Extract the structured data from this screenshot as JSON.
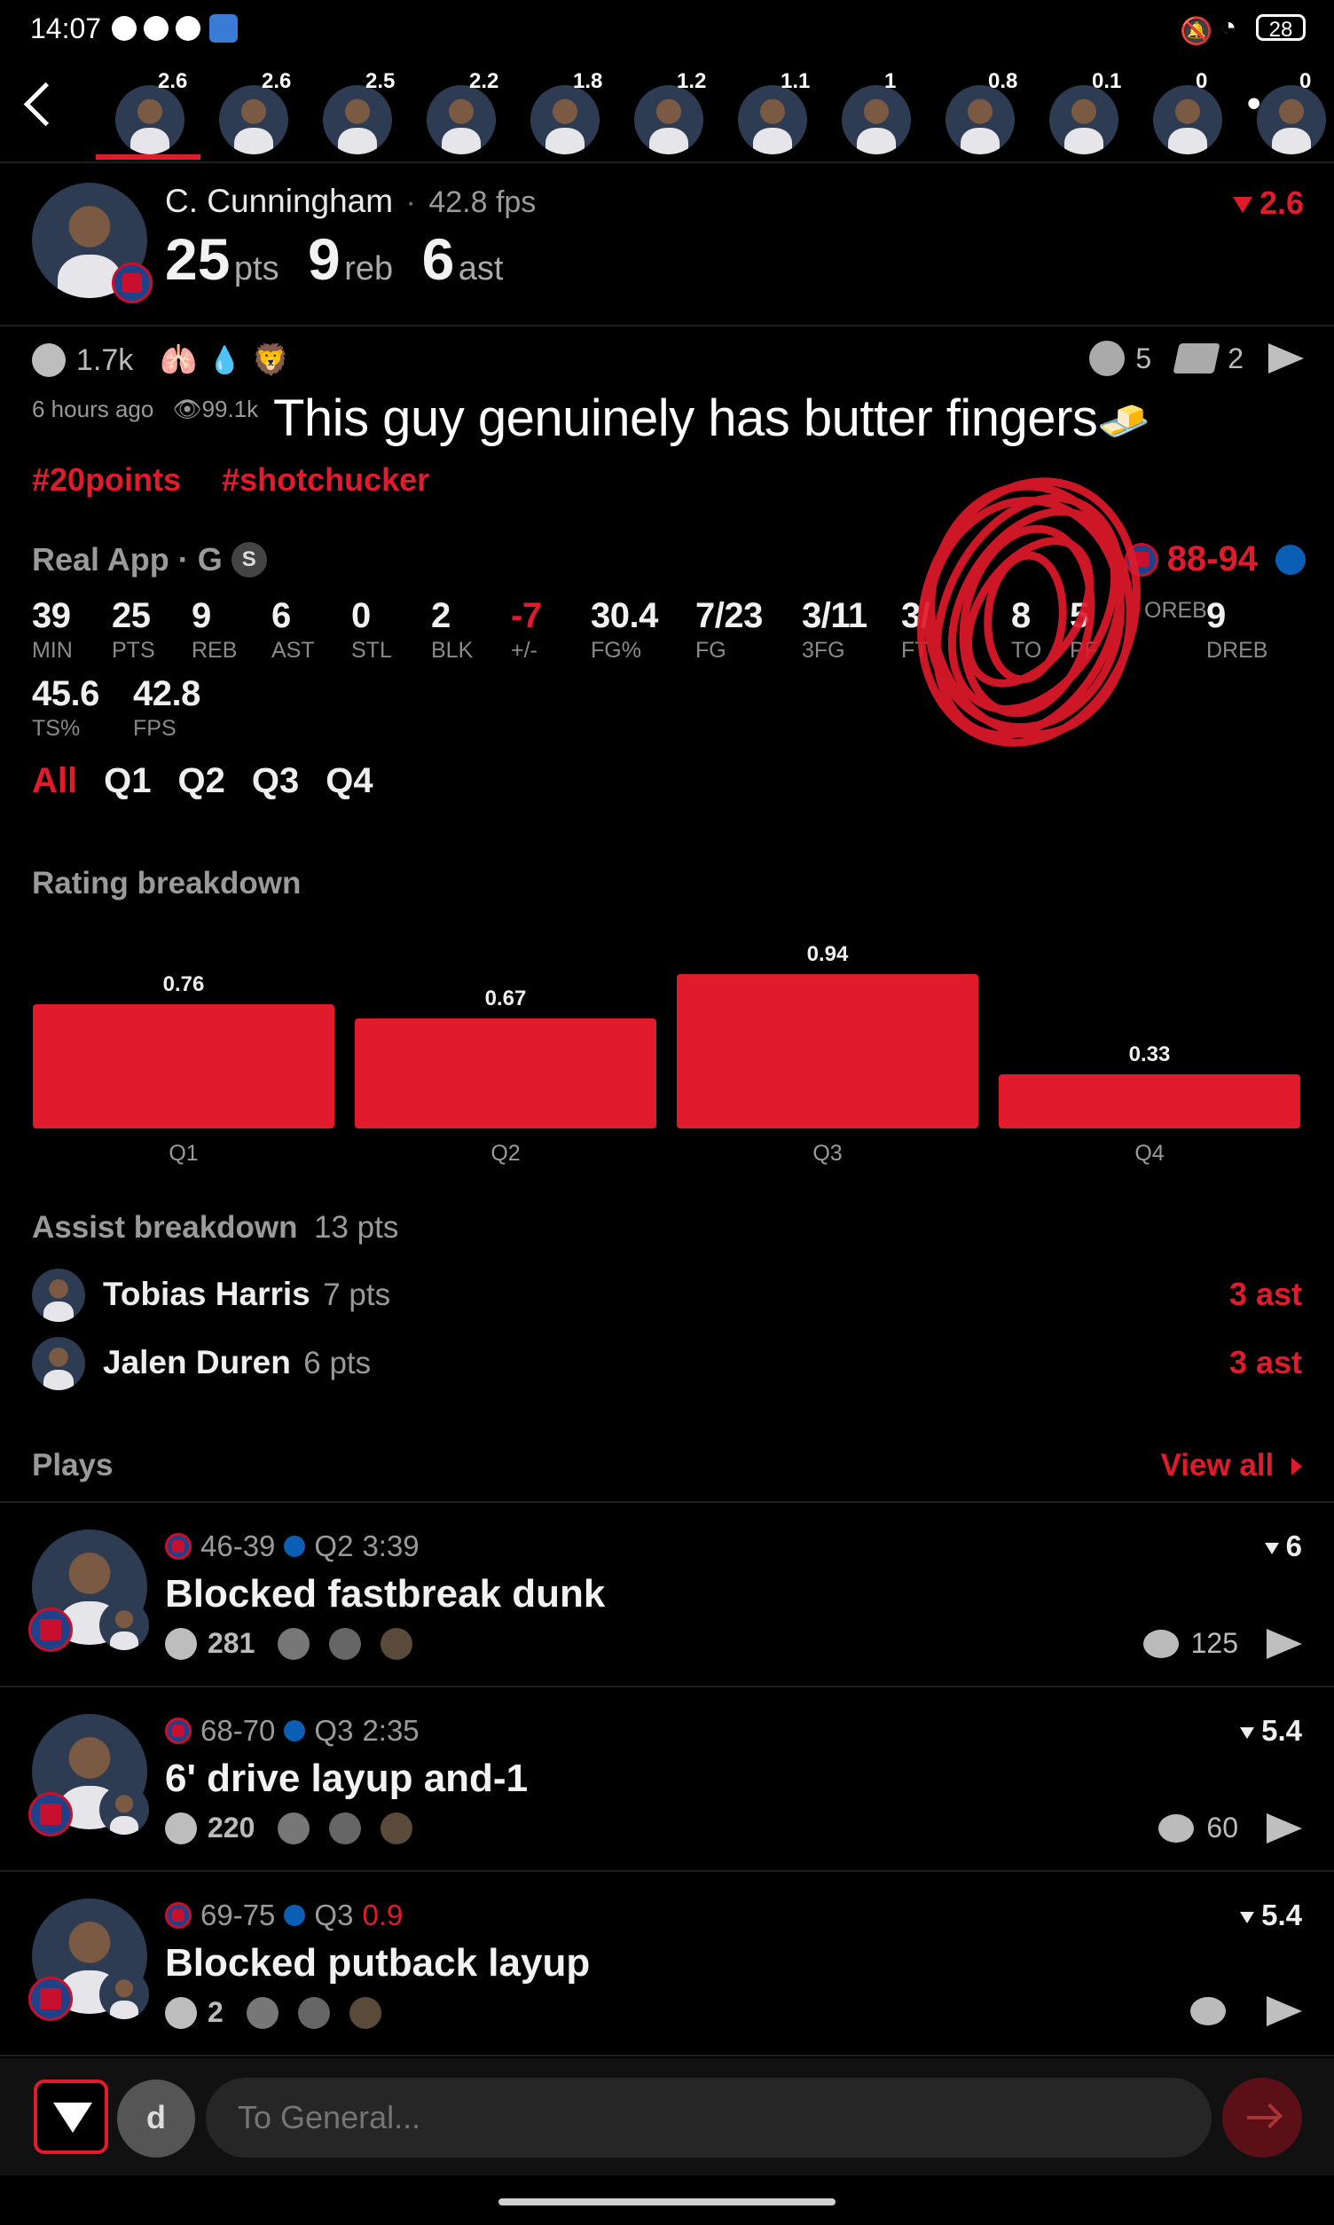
{
  "status_bar": {
    "time": "14:07",
    "battery": "28"
  },
  "player_strip": {
    "ratings": [
      "2.6",
      "2.6",
      "2.5",
      "2.2",
      "1.8",
      "1.2",
      "1.1",
      "1",
      "0.8",
      "0.1",
      "0",
      "0"
    ]
  },
  "player": {
    "name": "C. Cunningham",
    "fps": "42.8 fps",
    "pts_value": "25",
    "pts_label": "pts",
    "reb_value": "9",
    "reb_label": "reb",
    "ast_value": "6",
    "ast_label": "ast",
    "rating": "2.6"
  },
  "post": {
    "reactions_count": "1.7k",
    "comments_count": "5",
    "shares_count": "2",
    "time_ago": "6 hours ago",
    "views": "99.1k",
    "caption": "This guy genuinely has butter fingers",
    "caption_emoji": "🧈",
    "hashtags": [
      "#20points",
      "#shotchucker"
    ]
  },
  "box": {
    "source": "Real App",
    "position": "G",
    "starter_badge": "S",
    "score": "88-94",
    "stats_row1": [
      {
        "value": "39",
        "label": "MIN"
      },
      {
        "value": "25",
        "label": "PTS"
      },
      {
        "value": "9",
        "label": "REB"
      },
      {
        "value": "6",
        "label": "AST"
      },
      {
        "value": "0",
        "label": "STL"
      },
      {
        "value": "2",
        "label": "BLK"
      },
      {
        "value": "-7",
        "label": "+/-"
      },
      {
        "value": "30.4",
        "label": "FG%"
      },
      {
        "value": "7/23",
        "label": "FG"
      },
      {
        "value": "3/11",
        "label": "3FG"
      },
      {
        "value": "3/",
        "label": "FT"
      },
      {
        "value": "8",
        "label": "TO"
      },
      {
        "value": "5",
        "label": "PF"
      },
      {
        "value": "",
        "label": "OREB"
      },
      {
        "value": "9",
        "label": "DREB"
      }
    ],
    "stats_row2": [
      {
        "value": "45.6",
        "label": "TS%"
      },
      {
        "value": "42.8",
        "label": "FPS"
      }
    ],
    "periods": [
      "All",
      "Q1",
      "Q2",
      "Q3",
      "Q4"
    ]
  },
  "rating_breakdown": {
    "title": "Rating breakdown"
  },
  "chart_data": {
    "type": "bar",
    "categories": [
      "Q1",
      "Q2",
      "Q3",
      "Q4"
    ],
    "values": [
      0.76,
      0.67,
      0.94,
      0.33
    ],
    "ylim": [
      0,
      1
    ],
    "colors": [
      "#e21b2c"
    ]
  },
  "assist_breakdown": {
    "title": "Assist breakdown",
    "total": "13 pts",
    "rows": [
      {
        "name": "Tobias Harris",
        "pts": "7 pts",
        "ast": "3 ast"
      },
      {
        "name": "Jalen Duren",
        "pts": "6 pts",
        "ast": "3 ast"
      }
    ]
  },
  "plays": {
    "title": "Plays",
    "view_all": "View all",
    "items": [
      {
        "score": "46-39",
        "period": "Q2",
        "clock": "3:39",
        "title": "Blocked fastbreak dunk",
        "reactions": "281",
        "comments": "125",
        "rating": "6"
      },
      {
        "score": "68-70",
        "period": "Q3",
        "clock": "2:35",
        "title": "6' drive layup and-1",
        "reactions": "220",
        "comments": "60",
        "rating": "5.4"
      },
      {
        "score": "69-75",
        "period": "Q3",
        "clock": "0.9",
        "title": "Blocked putback layup",
        "reactions": "2",
        "comments": "",
        "rating": "5.4"
      }
    ]
  },
  "composer": {
    "user_initial": "d",
    "placeholder": "To General..."
  },
  "colors": {
    "accent": "#e21b2c",
    "background": "#000000"
  }
}
